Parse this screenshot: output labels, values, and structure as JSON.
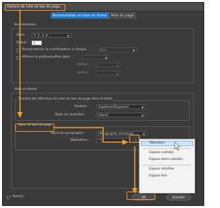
{
  "dialog": {
    "title": "Options de note de bas de page..."
  },
  "tabs": [
    {
      "label": "Numérotation et mise en forme",
      "active": true
    },
    {
      "label": "Mise en page",
      "active": false
    }
  ],
  "numbering": {
    "section_title": "Numérotation",
    "style_label": "Style :",
    "style_value": "1, 2, 3, 4...",
    "start_label": "Début :",
    "start_value": "1",
    "restart_label": "Recommencer la numérotation à chaque :",
    "restart_value": "Page",
    "prefix_suffix_label": "Afficher le préfixe/suffixe dans :",
    "prefix_label": "Préfixe :",
    "suffix_label": "Suffixe :"
  },
  "formatting": {
    "section_title": "Mise en forme",
    "ref_title": "Numéro de référence de note de bas de page dans le texte",
    "position_label": "Position :",
    "position_value": "Supérieur/Exposant",
    "char_style_label": "Style de caractère :",
    "char_style_value": "[Sans]",
    "footnote_title": "Note de bas de page",
    "para_style_label": "Style de paragraphe :",
    "para_style_value": "[Paragraphe standard]",
    "separator_label": "Séparateur :",
    "separator_value": "^t",
    "separator_button": "▸"
  },
  "separator_menu": {
    "items": [
      "Tabulation",
      "Espace cadratin",
      "Espace demi-cadratin",
      "Espace ultrafine",
      "Espace fine"
    ],
    "highlighted": "Tabulation"
  },
  "footer": {
    "preview_label": "Aperçu",
    "ok_label": "OK",
    "cancel_label": "Annuler"
  },
  "colors": {
    "annotation": "#f29a2e",
    "accent": "#1a73c8"
  }
}
